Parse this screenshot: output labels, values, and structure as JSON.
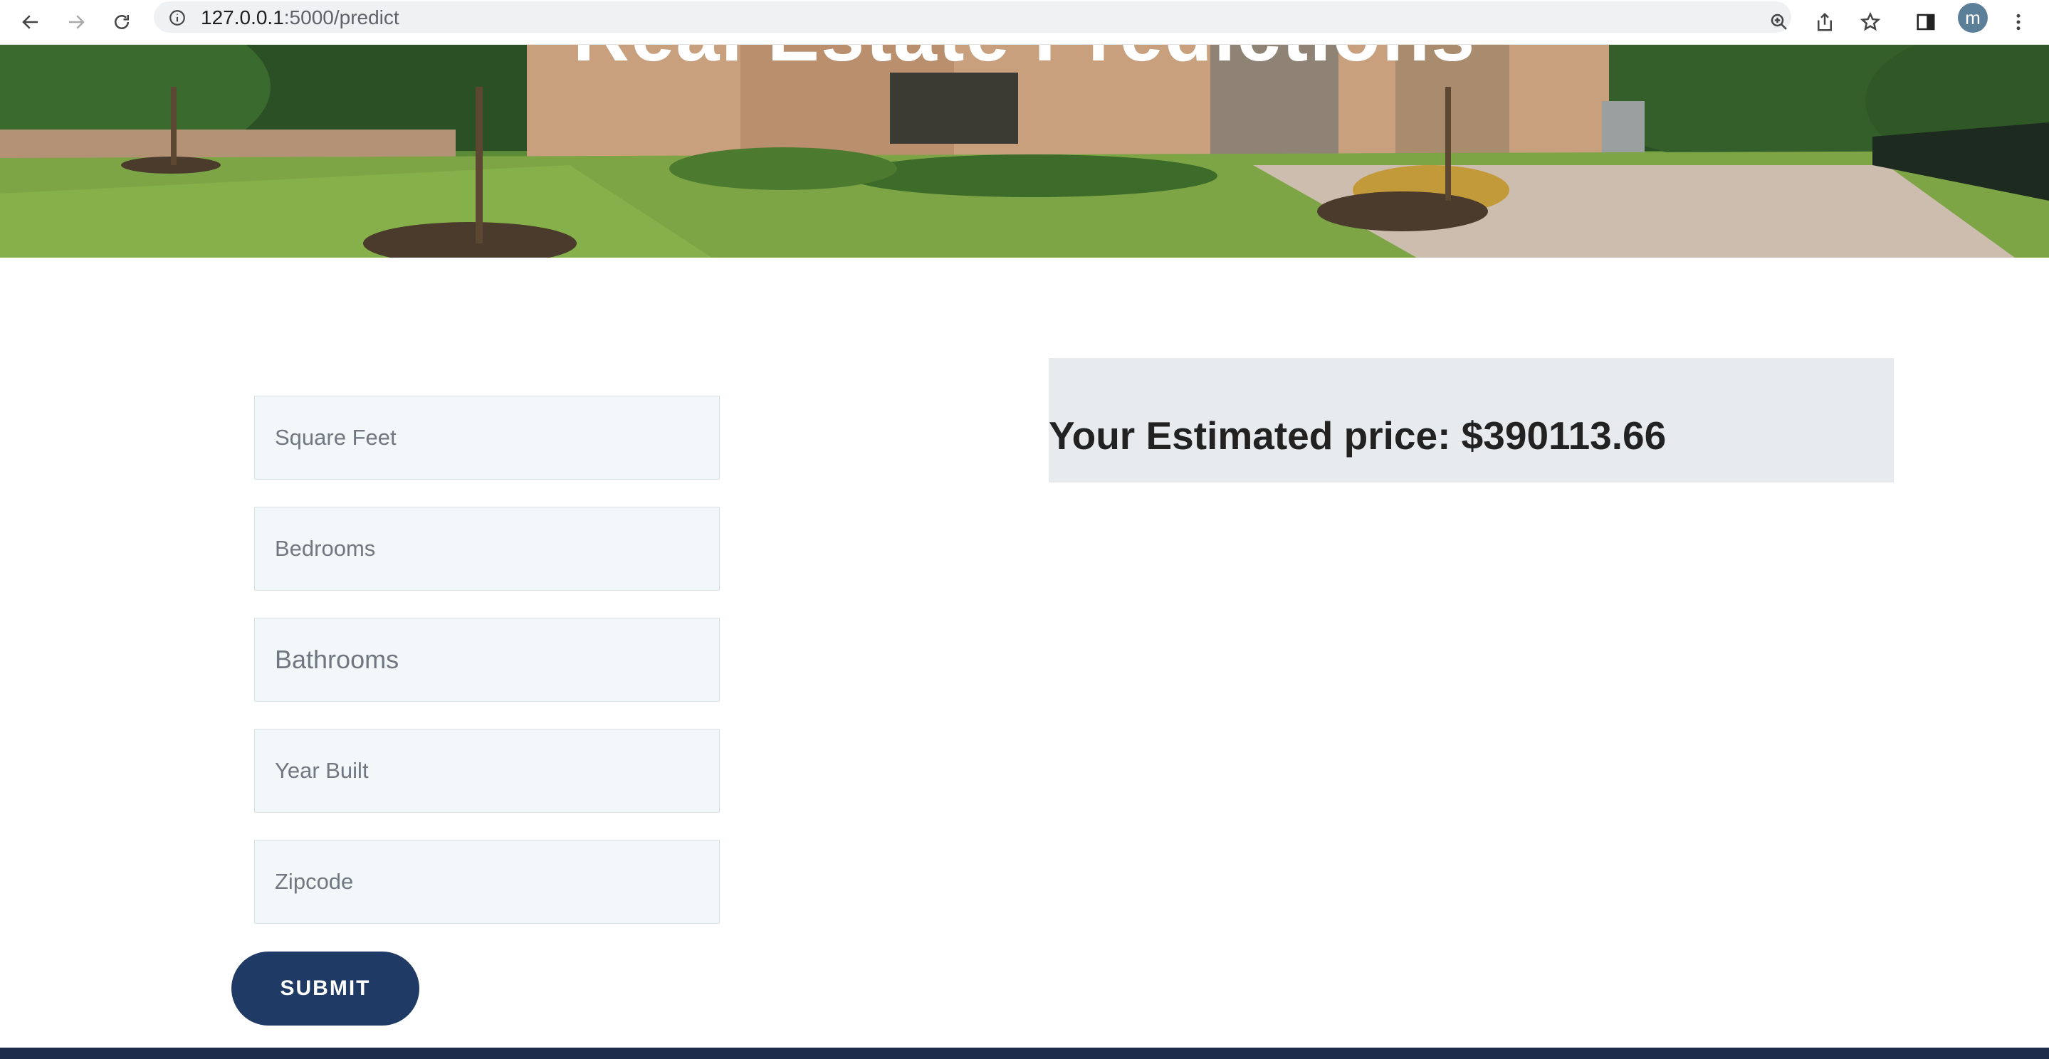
{
  "browser": {
    "url_host": "127.0.0.1",
    "url_rest": ":5000/predict",
    "profile_initial": "m"
  },
  "hero": {
    "title": "Real Estate Predictions"
  },
  "form": {
    "fields": [
      {
        "placeholder": "Square Feet"
      },
      {
        "placeholder": "Bedrooms"
      },
      {
        "placeholder": "Bathrooms"
      },
      {
        "placeholder": "Year Built"
      },
      {
        "placeholder": "Zipcode"
      }
    ],
    "submit_label": "SUBMIT"
  },
  "result": {
    "text": "Your Estimated price: $390113.66"
  },
  "colors": {
    "submit_bg": "#1f3a64",
    "result_bg": "#e8ebed",
    "field_bg": "#f2f7f9"
  }
}
